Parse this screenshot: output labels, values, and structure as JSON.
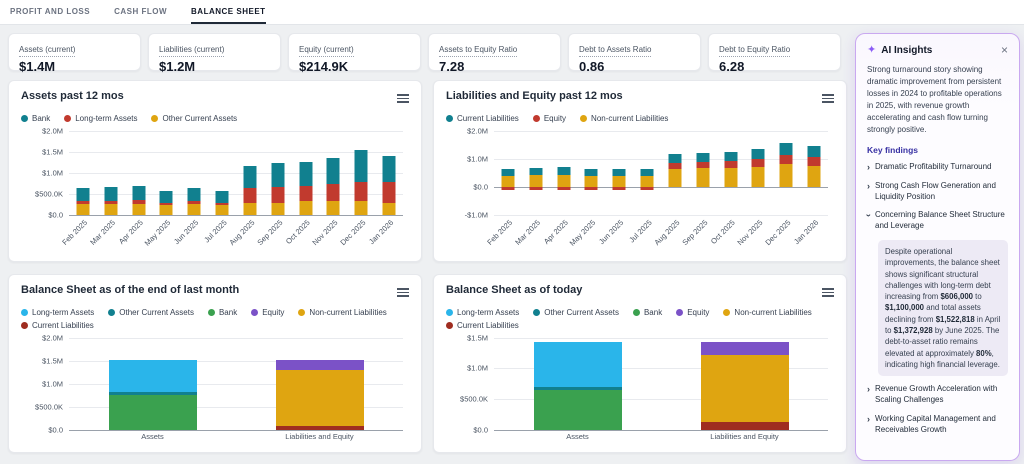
{
  "tabs": [
    {
      "label": "PROFIT AND LOSS",
      "active": false
    },
    {
      "label": "CASH FLOW",
      "active": false
    },
    {
      "label": "BALANCE SHEET",
      "active": true
    }
  ],
  "kpis": [
    {
      "label": "Assets (current)",
      "value": "$1.4M"
    },
    {
      "label": "Liabilities (current)",
      "value": "$1.2M"
    },
    {
      "label": "Equity (current)",
      "value": "$214.9K"
    },
    {
      "label": "Assets to Equity Ratio",
      "value": "7.28"
    },
    {
      "label": "Debt to Assets Ratio",
      "value": "0.86"
    },
    {
      "label": "Debt to Equity Ratio",
      "value": "6.28"
    }
  ],
  "chart_data": [
    {
      "type": "bar",
      "stacked": true,
      "title": "Assets past 12 mos",
      "ymin": 0,
      "ymax": 2000,
      "unit": "$K",
      "yticks": [
        {
          "v": 0,
          "label": "$0.0"
        },
        {
          "v": 500,
          "label": "$500.0K"
        },
        {
          "v": 1000,
          "label": "$1.0M"
        },
        {
          "v": 1500,
          "label": "$1.5M"
        },
        {
          "v": 2000,
          "label": "$2.0M"
        }
      ],
      "categories": [
        "Feb 2025",
        "Mar 2025",
        "Apr 2025",
        "May 2025",
        "Jun 2025",
        "Jul 2025",
        "Aug 2025",
        "Sep 2025",
        "Oct 2025",
        "Nov 2025",
        "Dec 2025",
        "Jan 2026"
      ],
      "rotate_x_labels": true,
      "series": [
        {
          "name": "Bank",
          "color": "#11808f",
          "values": [
            310,
            335,
            355,
            285,
            310,
            265,
            525,
            550,
            570,
            640,
            765,
            615
          ]
        },
        {
          "name": "Long-term Assets",
          "color": "#c13a2e",
          "values": [
            70,
            70,
            95,
            70,
            70,
            70,
            355,
            380,
            380,
            405,
            450,
            500
          ]
        },
        {
          "name": "Other Current Assets",
          "color": "#dfa511",
          "values": [
            240,
            260,
            240,
            215,
            240,
            215,
            285,
            285,
            310,
            310,
            330,
            285
          ]
        }
      ],
      "stack_order": [
        2,
        1,
        0
      ]
    },
    {
      "type": "bar",
      "stacked": true,
      "title": "Liabilities and Equity past 12 mos",
      "ymin": -1000,
      "ymax": 2000,
      "unit": "$K",
      "yticks": [
        {
          "v": -1000,
          "label": "-$1.0M"
        },
        {
          "v": 0,
          "label": "$0.0"
        },
        {
          "v": 1000,
          "label": "$1.0M"
        },
        {
          "v": 2000,
          "label": "$2.0M"
        }
      ],
      "categories": [
        "Feb 2025",
        "Mar 2025",
        "Apr 2025",
        "May 2025",
        "Jun 2025",
        "Jul 2025",
        "Aug 2025",
        "Sep 2025",
        "Oct 2025",
        "Nov 2025",
        "Dec 2025",
        "Jan 2026"
      ],
      "rotate_x_labels": true,
      "series": [
        {
          "name": "Current Liabilities",
          "color": "#11808f",
          "values": [
            260,
            270,
            260,
            240,
            250,
            240,
            310,
            320,
            330,
            350,
            400,
            380
          ]
        },
        {
          "name": "Equity",
          "color": "#c13a2e",
          "values": [
            -120,
            -130,
            -140,
            -110,
            -120,
            -110,
            230,
            240,
            260,
            290,
            340,
            310
          ]
        },
        {
          "name": "Non-current Liabilities",
          "color": "#dfa511",
          "values": [
            380,
            400,
            420,
            370,
            390,
            370,
            620,
            650,
            660,
            700,
            800,
            750
          ]
        }
      ],
      "stack_order": [
        2,
        1,
        0
      ]
    },
    {
      "type": "bar",
      "stacked": true,
      "title": "Balance Sheet as of the end of last month",
      "ymin": 0,
      "ymax": 2000,
      "unit": "$K",
      "yticks": [
        {
          "v": 0,
          "label": "$0.0"
        },
        {
          "v": 500,
          "label": "$500.0K"
        },
        {
          "v": 1000,
          "label": "$1.0M"
        },
        {
          "v": 1500,
          "label": "$1.5M"
        },
        {
          "v": 2000,
          "label": "$2.0M"
        }
      ],
      "categories": [
        "Assets",
        "Liabilities and Equity"
      ],
      "rotate_x_labels": false,
      "series": [
        {
          "name": "Long-term Assets",
          "color": "#2ab5ea",
          "values": [
            700,
            0
          ]
        },
        {
          "name": "Other Current Assets",
          "color": "#11808f",
          "values": [
            70,
            0
          ]
        },
        {
          "name": "Bank",
          "color": "#3aa14f",
          "values": [
            750,
            0
          ]
        },
        {
          "name": "Equity",
          "color": "#7b52c7",
          "values": [
            0,
            230
          ]
        },
        {
          "name": "Non-current Liabilities",
          "color": "#dfa511",
          "values": [
            0,
            1200
          ]
        },
        {
          "name": "Current Liabilities",
          "color": "#9f2d20",
          "values": [
            0,
            85
          ]
        }
      ],
      "stack_order": [
        2,
        1,
        0,
        5,
        4,
        3
      ]
    },
    {
      "type": "bar",
      "stacked": true,
      "title": "Balance Sheet as of today",
      "ymin": 0,
      "ymax": 1500,
      "unit": "$K",
      "yticks": [
        {
          "v": 0,
          "label": "$0.0"
        },
        {
          "v": 500,
          "label": "$500.0K"
        },
        {
          "v": 1000,
          "label": "$1.0M"
        },
        {
          "v": 1500,
          "label": "$1.5M"
        }
      ],
      "categories": [
        "Assets",
        "Liabilities and Equity"
      ],
      "rotate_x_labels": false,
      "series": [
        {
          "name": "Long-term Assets",
          "color": "#2ab5ea",
          "values": [
            740,
            0
          ]
        },
        {
          "name": "Other Current Assets",
          "color": "#11808f",
          "values": [
            45,
            0
          ]
        },
        {
          "name": "Bank",
          "color": "#3aa14f",
          "values": [
            650,
            0
          ]
        },
        {
          "name": "Equity",
          "color": "#7b52c7",
          "values": [
            0,
            215
          ]
        },
        {
          "name": "Non-current Liabilities",
          "color": "#dfa511",
          "values": [
            0,
            1100
          ]
        },
        {
          "name": "Current Liabilities",
          "color": "#9f2d20",
          "values": [
            0,
            120
          ]
        }
      ],
      "stack_order": [
        2,
        1,
        0,
        5,
        4,
        3
      ]
    }
  ],
  "ai_panel": {
    "title": "AI Insights",
    "sparkle_icon": "✦",
    "close_icon": "×",
    "summary": "Strong turnaround story showing dramatic improvement from persistent losses in 2024 to profitable operations in 2025, with revenue growth accelerating and cash flow turning strongly positive.",
    "key_findings_label": "Key findings",
    "findings": [
      {
        "label": "Dramatic Profitability Turnaround",
        "expanded": false
      },
      {
        "label": "Strong Cash Flow Generation and Liquidity Position",
        "expanded": false
      },
      {
        "label": "Concerning Balance Sheet Structure and Leverage",
        "expanded": true,
        "detail": [
          {
            "text": "Despite operational improvements, the balance sheet shows significant structural challenges with long-term debt increasing from "
          },
          {
            "text": "$606,000",
            "bold": true
          },
          {
            "text": " to "
          },
          {
            "text": "$1,100,000",
            "bold": true
          },
          {
            "text": " and total assets declining from "
          },
          {
            "text": "$1,522,818",
            "bold": true
          },
          {
            "text": " in April to "
          },
          {
            "text": "$1,372,928",
            "bold": true
          },
          {
            "text": " by June 2025. The debt-to-asset ratio remains elevated at approximately "
          },
          {
            "text": "80%",
            "bold": true
          },
          {
            "text": ", indicating high financial leverage."
          }
        ]
      },
      {
        "label": "Revenue Growth Acceleration with Scaling Challenges",
        "expanded": false
      },
      {
        "label": "Working Capital Management and Receivables Growth",
        "expanded": false
      }
    ]
  }
}
